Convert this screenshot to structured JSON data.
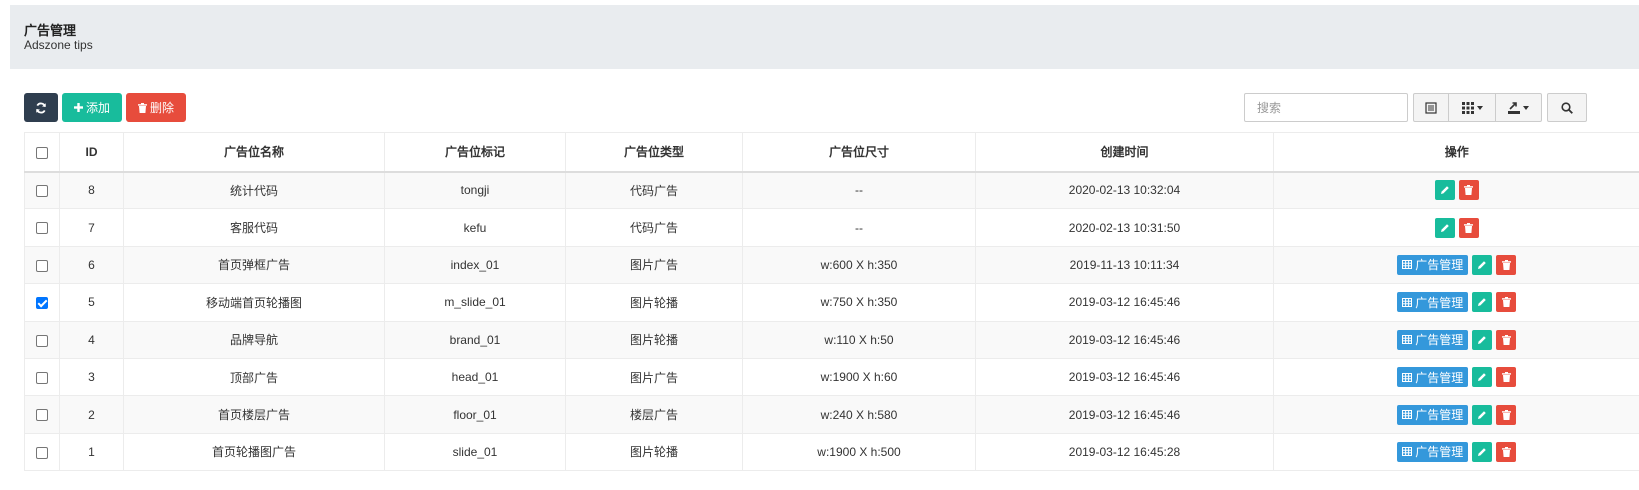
{
  "header": {
    "title": "广告管理",
    "subtitle": "Adszone tips"
  },
  "toolbar": {
    "add_label": "添加",
    "delete_label": "删除",
    "search_placeholder": "搜索"
  },
  "table": {
    "columns": [
      "ID",
      "广告位名称",
      "广告位标记",
      "广告位类型",
      "广告位尺寸",
      "创建时间",
      "操作"
    ],
    "manage_label": "广告管理",
    "rows": [
      {
        "checked": false,
        "id": "8",
        "name": "统计代码",
        "mark": "tongji",
        "type": "代码广告",
        "size": "--",
        "created": "2020-02-13 10:32:04",
        "manage": false
      },
      {
        "checked": false,
        "id": "7",
        "name": "客服代码",
        "mark": "kefu",
        "type": "代码广告",
        "size": "--",
        "created": "2020-02-13 10:31:50",
        "manage": false
      },
      {
        "checked": false,
        "id": "6",
        "name": "首页弹框广告",
        "mark": "index_01",
        "type": "图片广告",
        "size": "w:600 X h:350",
        "created": "2019-11-13 10:11:34",
        "manage": true
      },
      {
        "checked": true,
        "id": "5",
        "name": "移动端首页轮播图",
        "mark": "m_slide_01",
        "type": "图片轮播",
        "size": "w:750 X h:350",
        "created": "2019-03-12 16:45:46",
        "manage": true
      },
      {
        "checked": false,
        "id": "4",
        "name": "品牌导航",
        "mark": "brand_01",
        "type": "图片轮播",
        "size": "w:110 X h:50",
        "created": "2019-03-12 16:45:46",
        "manage": true
      },
      {
        "checked": false,
        "id": "3",
        "name": "顶部广告",
        "mark": "head_01",
        "type": "图片广告",
        "size": "w:1900 X h:60",
        "created": "2019-03-12 16:45:46",
        "manage": true
      },
      {
        "checked": false,
        "id": "2",
        "name": "首页楼层广告",
        "mark": "floor_01",
        "type": "楼层广告",
        "size": "w:240 X h:580",
        "created": "2019-03-12 16:45:46",
        "manage": true
      },
      {
        "checked": false,
        "id": "1",
        "name": "首页轮播图广告",
        "mark": "slide_01",
        "type": "图片轮播",
        "size": "w:1900 X h:500",
        "created": "2019-03-12 16:45:28",
        "manage": true
      }
    ]
  }
}
